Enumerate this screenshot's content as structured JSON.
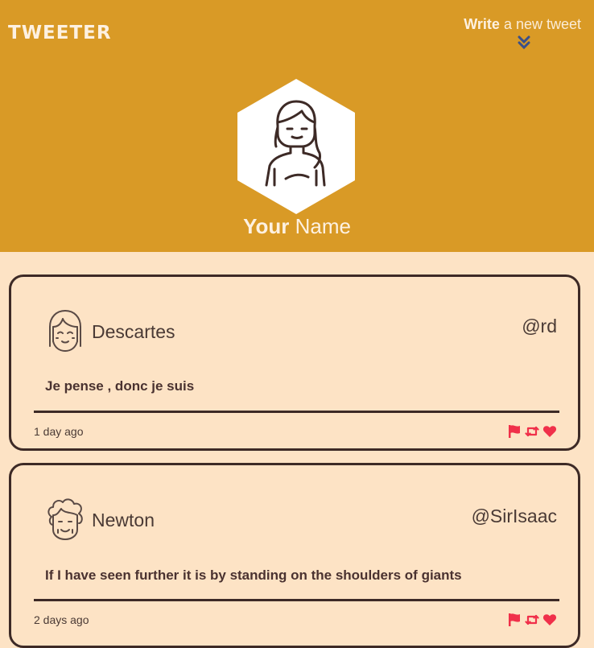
{
  "header": {
    "brand": "TWEETER",
    "write_bold": "Write",
    "write_light": " a new tweet",
    "name_bold": "Your",
    "name_light": " Name"
  },
  "tweets": [
    {
      "name": "Descartes",
      "handle": "@rd",
      "text": "Je pense , donc je suis",
      "time": "1 day ago"
    },
    {
      "name": "Newton",
      "handle": "@SirIsaac",
      "text": "If I have seen further it is by standing on the shoulders of giants",
      "time": "2 days ago"
    }
  ],
  "colors": {
    "header_bg": "#d99a26",
    "page_bg": "#fde3c5",
    "ink": "#3d2a26",
    "action_red": "#f0304a",
    "chevron_blue": "#3a4f8a"
  },
  "icons": {
    "flag": "flag-icon",
    "retweet": "retweet-icon",
    "like": "heart-icon"
  }
}
